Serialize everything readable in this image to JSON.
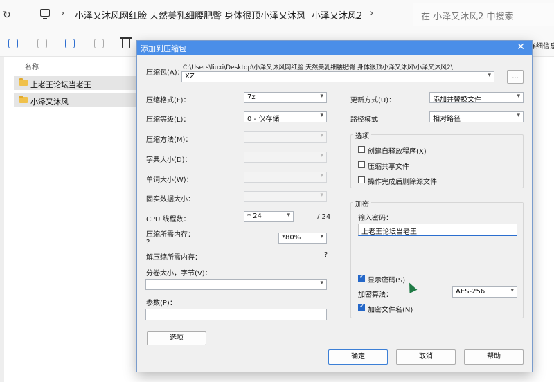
{
  "explorer": {
    "breadcrumbs": [
      "小泽又沐风网红脸 天然美乳细腰肥臀 身体很顶小泽又沐风",
      "小泽又沐风2"
    ],
    "search_placeholder": "在 小泽又沐风2 中搜索",
    "toolbar_right_label": "详细信息",
    "column_name": "名称",
    "files": [
      "上老王论坛当老王",
      "小泽又沐风"
    ]
  },
  "dialog": {
    "title": "添加到压缩包",
    "archive_label": "压缩包(A)：",
    "archive_path": "C:\\Users\\liuxi\\Desktop\\小泽又沐风网红脸 天然美乳细腰肥臀 身体很顶小泽又沐风\\小泽又沐风2\\",
    "archive_name": "XZ",
    "browse_label": "...",
    "format_label": "压缩格式(F)：",
    "format_value": "7z",
    "level_label": "压缩等级(L)：",
    "level_value": "0 - 仅存储",
    "method_label": "压缩方法(M)：",
    "dict_label": "字典大小(D)：",
    "word_label": "单词大小(W)：",
    "solid_label": "固实数据大小：",
    "cpu_label": "CPU 线程数：",
    "cpu_value": "* 24",
    "cpu_max": "/ 24",
    "mem_label": "压缩所需内存：",
    "mem_q": "?",
    "mem_value": "*80%",
    "demem_label": "解压缩所需内存：",
    "demem_value": "?",
    "split_label": "分卷大小，字节(V)：",
    "params_label": "参数(P)：",
    "options_button": "选项",
    "update_label": "更新方式(U)：",
    "update_value": "添加并替换文件",
    "path_label": "路径模式",
    "path_value": "相对路径",
    "options_group": "选项",
    "opt_sfx": "创建自释放程序(X)",
    "opt_shared": "压缩共享文件",
    "opt_delete": "操作完成后删除源文件",
    "encrypt_group": "加密",
    "pwd_label": "输入密码：",
    "pwd_value": "上老王论坛当老王",
    "show_pwd": "显示密码(S)",
    "algo_label": "加密算法：",
    "algo_value": "AES-256",
    "encrypt_names": "加密文件名(N)",
    "ok": "确定",
    "cancel": "取消",
    "help": "帮助"
  }
}
